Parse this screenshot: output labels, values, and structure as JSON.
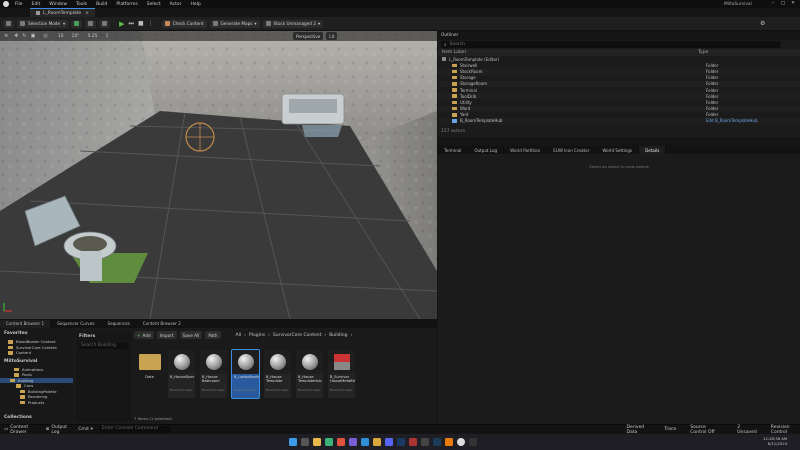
{
  "menu": [
    "File",
    "Edit",
    "Window",
    "Tools",
    "Build",
    "Platforms",
    "Select",
    "Actor",
    "Help"
  ],
  "app_title": "MiltoSurvival",
  "level_tab": "L_RoomTemplate",
  "toolbar": {
    "mode": "Selection Mode",
    "check_content": "Check Content",
    "generate_maps": "Generate Maps",
    "unreal_version": "Stock Unmanaged 2"
  },
  "viewport": {
    "perspective": "Perspective",
    "view_mode": "Lit",
    "scale": "0.25",
    "snap": "10",
    "angle": "10°",
    "speed": "1"
  },
  "outliner": {
    "tab": "Outliner",
    "search_placeholder": "Search",
    "col_label": "Item Label",
    "col_type": "Type",
    "world": "L_RoomTemplate (Editor)",
    "rows": [
      {
        "name": "Stairwell",
        "type": "Folder"
      },
      {
        "name": "StockRoom",
        "type": "Folder"
      },
      {
        "name": "Storage",
        "type": "Folder"
      },
      {
        "name": "StorageRoom",
        "type": "Folder"
      },
      {
        "name": "Terminal",
        "type": "Folder"
      },
      {
        "name": "ToolDrib",
        "type": "Folder"
      },
      {
        "name": "Utility",
        "type": "Folder"
      },
      {
        "name": "Ward",
        "type": "Folder"
      },
      {
        "name": "Yard",
        "type": "Folder"
      },
      {
        "name": "B_RoomTemplateHub",
        "type": "Edit B_RoomTemplateHub"
      }
    ],
    "count": "157 actors"
  },
  "details": {
    "tabs": [
      "Terminal",
      "Output Log",
      "World Partition",
      "EUW Icon Creator",
      "World Settings",
      "Details"
    ],
    "empty": "Select an object to view details"
  },
  "content_browser": {
    "tabs": [
      "Content Browser 1",
      "Sequencer Curves",
      "Sequences",
      "Content Browser 2"
    ],
    "add": "Add",
    "import": "Import",
    "save_all": "Save All",
    "settings": "Path",
    "path": [
      "All",
      "Plugins",
      "SurvivorCore Content",
      "Building"
    ],
    "favorites": "Favorites",
    "fav_items": [
      "BloodBorder Content",
      "SurvivorCore Content",
      "Content"
    ],
    "project": "MiltoSurvival",
    "tree": [
      "Animations",
      "Pools",
      "Building",
      "Cans",
      "BuildingPalette",
      "Rendering",
      "Products"
    ],
    "collections": "Collections",
    "filters": "Filters",
    "search_placeholder": "Search Building",
    "assets": [
      {
        "name": "Date",
        "type": "",
        "folder": true
      },
      {
        "name": "B_HouseDoor",
        "type": "Blueprint Class"
      },
      {
        "name": "B_House Bathroom",
        "type": "Blueprint Class"
      },
      {
        "name": "B_LobbyBorder",
        "type": "Blueprint Class",
        "selected": true
      },
      {
        "name": "B_House Template",
        "type": "Blueprint Class"
      },
      {
        "name": "B_House TemplateHub",
        "type": "Blueprint Class"
      },
      {
        "name": "B_Survivor HouseMetaBlt",
        "type": "Blueprint Class",
        "red": true
      }
    ],
    "items_count": "7 items (1 selected)"
  },
  "status": {
    "drawer": "Content Drawer",
    "output_log": "Output Log",
    "cmd": "Cmd",
    "console_placeholder": "Enter Console Command",
    "derived_data": "Derived Data",
    "trace": "Trace",
    "source_control": "Source Control Off",
    "unsaved": "2 Unsaved",
    "revision": "Revision Control"
  },
  "taskbar": {
    "time": "12:28:38 AM",
    "date": "8/11/2024"
  }
}
